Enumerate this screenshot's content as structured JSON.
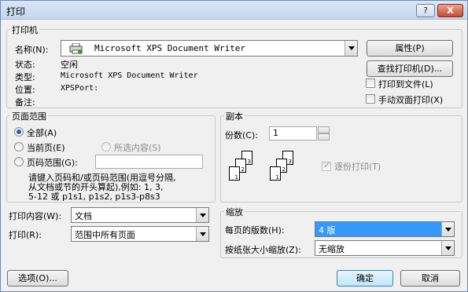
{
  "window": {
    "title": "打印",
    "help_btn": "?",
    "close_btn": "X"
  },
  "printer": {
    "group_label": "打印机",
    "name_label": "名称(N):",
    "name_value": "Microsoft XPS Document Writer",
    "status_label": "状态:",
    "status_value": "空闲",
    "type_label": "类型:",
    "type_value": "Microsoft XPS Document Writer",
    "where_label": "位置:",
    "where_value": "XPSPort:",
    "comment_label": "备注:",
    "properties_btn": "属性(P)",
    "find_btn": "查找打印机(D)...",
    "print_to_file": "打印到文件(L)",
    "manual_duplex": "手动双面打印(X)"
  },
  "range": {
    "group_label": "页面范围",
    "all": "全部(A)",
    "current": "当前页(E)",
    "selection": "所选内容(S)",
    "pages": "页码范围(G):",
    "help_line1": "请键入页码和/或页码范围(用逗号分隔,",
    "help_line2": "从文档或节的开头算起),例如: 1, 3,",
    "help_line3": "5-12 或 p1s1, p1s2, p1s3-p8s3"
  },
  "copies": {
    "group_label": "副本",
    "count_label": "份数(C):",
    "count_value": "1",
    "collate": "逐份打印(T)"
  },
  "print_what": {
    "label": "打印内容(W):",
    "value": "文档"
  },
  "print_sel": {
    "label": "打印(R):",
    "value": "范围中所有页面"
  },
  "zoom": {
    "group_label": "缩放",
    "pages_per_sheet_label": "每页的版数(H):",
    "pages_per_sheet_value": "4 版",
    "scale_label": "按纸张大小缩放(Z):",
    "scale_value": "无缩放"
  },
  "buttons": {
    "options": "选项(O)...",
    "ok": "确定",
    "cancel": "取消"
  }
}
